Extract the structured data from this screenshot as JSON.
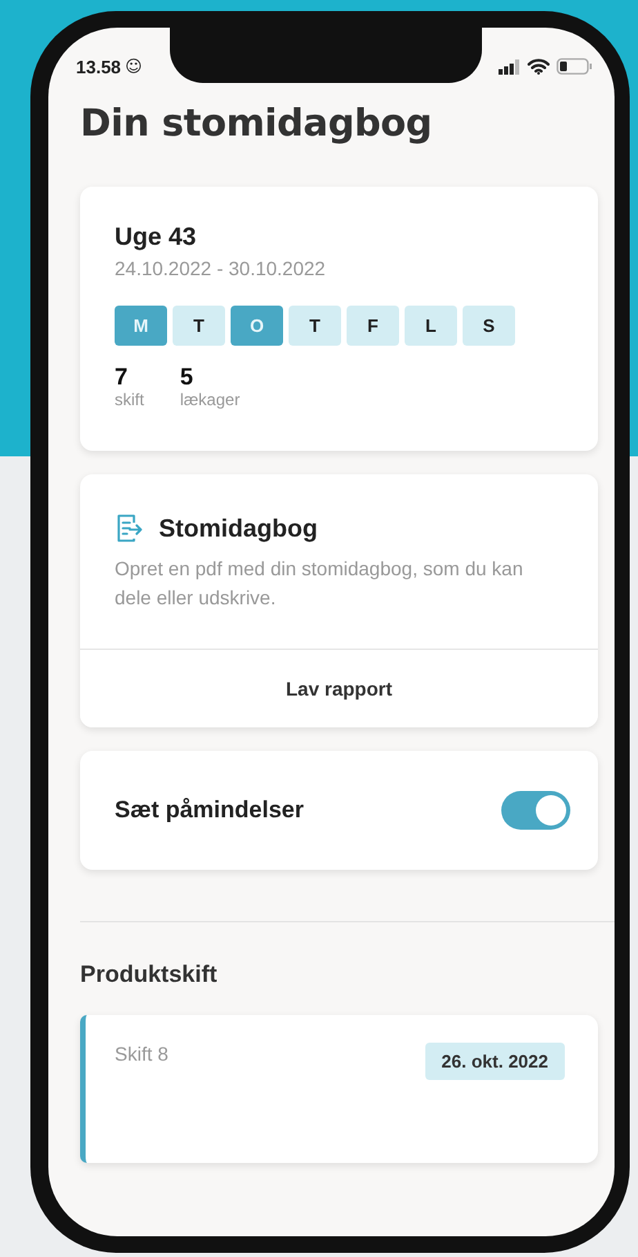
{
  "status_bar": {
    "time": "13.58",
    "emoji": "☺"
  },
  "title": "Din stomidagbog",
  "week_card": {
    "title": "Uge 43",
    "dates": "24.10.2022 - 30.10.2022",
    "days": [
      {
        "label": "M",
        "marked": true
      },
      {
        "label": "T",
        "marked": false
      },
      {
        "label": "O",
        "marked": true
      },
      {
        "label": "T",
        "marked": false
      },
      {
        "label": "F",
        "marked": false
      },
      {
        "label": "L",
        "marked": false
      },
      {
        "label": "S",
        "marked": false
      }
    ],
    "stats": [
      {
        "value": "7",
        "label": "skift"
      },
      {
        "value": "5",
        "label": "lækager"
      }
    ]
  },
  "report_card": {
    "title": "Stomidagbog",
    "description": "Opret en pdf med din stomidagbog, som du kan dele eller udskrive.",
    "button": "Lav rapport"
  },
  "reminder": {
    "label": "Sæt påmindelser",
    "on": true
  },
  "section_title": "Produktskift",
  "product_changes": [
    {
      "title": "Skift 8",
      "date": "26. okt. 2022"
    }
  ]
}
